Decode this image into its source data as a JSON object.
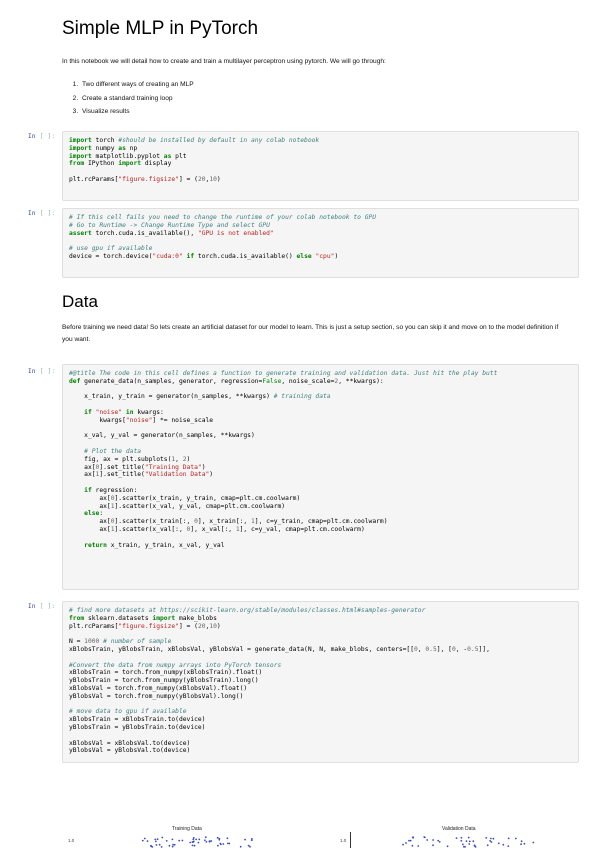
{
  "title": "Simple MLP in PyTorch",
  "intro": "In this notebook we will detail how to create and train a multilayer perceptron using pytorch. We will go through:",
  "steps": [
    "Two different ways of creating an MLP",
    "Create a standard training loop",
    "Visualize results"
  ],
  "prompt_label": "In",
  "prompt_bracket": "[ ]:",
  "data_heading": "Data",
  "data_intro": "Before training we need data! So lets create an artificial dataset for our model to learn. This is just a setup section, so you can skip it and move on to the model definition if you want.",
  "cells": [
    {
      "lines": [
        "import torch #should be installed by default in any colab notebook",
        "import numpy as np",
        "import matplotlib.pyplot as plt",
        "from IPython import display",
        "",
        "plt.rcParams[\"figure.figsize\"] = (20,10)"
      ]
    },
    {
      "lines": [
        "# If this cell fails you need to change the runtime of your colab notebook to GPU",
        "# Go to Runtime -> Change Runtime Type and select GPU",
        "assert torch.cuda.is_available(), \"GPU is not enabled\"",
        "",
        "# use gpu if available",
        "device = torch.device(\"cuda:0\" if torch.cuda.is_available() else \"cpu\")"
      ]
    },
    {
      "lines": [
        "#@title The code in this cell defines a function to generate training and validation data. Just hit the play butt",
        "def generate_data(n_samples, generator, regression=False, noise_scale=2, **kwargs):",
        "",
        "    x_train, y_train = generator(n_samples, **kwargs) # training data",
        "",
        "    if \"noise\" in kwargs:",
        "        kwargs[\"noise\"] *= noise_scale",
        "",
        "    x_val, y_val = generator(n_samples, **kwargs)",
        "",
        "    # Plot the data",
        "    fig, ax = plt.subplots(1, 2)",
        "    ax[0].set_title(\"Training Data\")",
        "    ax[1].set_title(\"Validation Data\")",
        "",
        "    if regression:",
        "        ax[0].scatter(x_train, y_train, cmap=plt.cm.coolwarm)",
        "        ax[1].scatter(x_val, y_val, cmap=plt.cm.coolwarm)",
        "    else:",
        "        ax[0].scatter(x_train[:, 0], x_train[:, 1], c=y_train, cmap=plt.cm.coolwarm)",
        "        ax[1].scatter(x_val[:, 0], x_val[:, 1], c=y_val, cmap=plt.cm.coolwarm)",
        "",
        "    return x_train, y_train, x_val, y_val"
      ]
    },
    {
      "lines": [
        "# find more datasets at https://scikit-learn.org/stable/modules/classes.html#samples-generator",
        "from sklearn.datasets import make_blobs",
        "plt.rcParams[\"figure.figsize\"] = (20,10)",
        "",
        "N = 1000 # number of sample",
        "xBlobsTrain, yBlobsTrain, xBlobsVal, yBlobsVal = generate_data(N, N, make_blobs, centers=[[0, 0.5], [0, -0.5]],",
        "",
        "#Convert the data from numpy arrays into PyTorch tensors",
        "xBlobsTrain = torch.from_numpy(xBlobsTrain).float()",
        "yBlobsTrain = torch.from_numpy(yBlobsTrain).long()",
        "xBlobsVal = torch.from_numpy(xBlobsVal).float()",
        "yBlobsVal = torch.from_numpy(yBlobsVal).long()",
        "",
        "# move data to gpu if available",
        "xBlobsTrain = xBlobsTrain.to(device)",
        "yBlobsTrain = yBlobsTrain.to(device)",
        "",
        "xBlobsVal = xBlobsVal.to(device)",
        "yBlobsVal = yBlobsVal.to(device)"
      ]
    }
  ],
  "output": {
    "left_title": "Training Data",
    "right_title": "Validation Data",
    "left_tick": "1.0",
    "right_tick": "1.0",
    "point_color": "#3b4cc0"
  }
}
